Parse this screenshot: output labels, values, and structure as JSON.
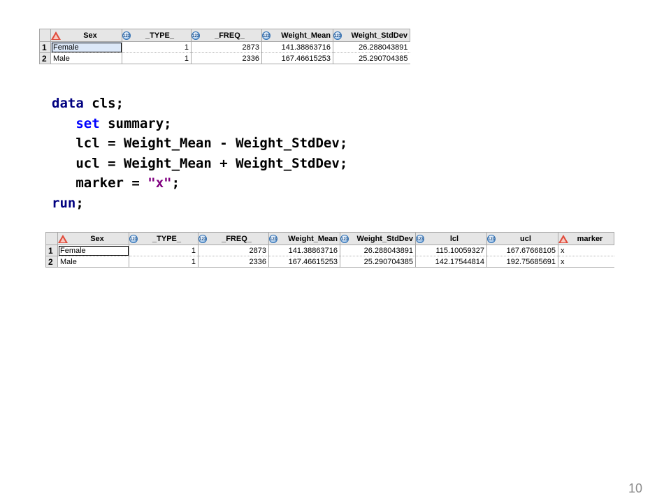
{
  "table1": {
    "columns": [
      "Sex",
      "_TYPE_",
      "_FREQ_",
      "Weight_Mean",
      "Weight_StdDev"
    ],
    "rows": [
      {
        "num": "1",
        "Sex": "Female",
        "TYPE": "1",
        "FREQ": "2873",
        "Weight_Mean": "141.38863716",
        "Weight_StdDev": "26.288043891"
      },
      {
        "num": "2",
        "Sex": "Male",
        "TYPE": "1",
        "FREQ": "2336",
        "Weight_Mean": "167.46615253",
        "Weight_StdDev": "25.290704385"
      }
    ]
  },
  "code": {
    "line1_kw": "data",
    "line1_rest": " cls;",
    "line2_kw": "set",
    "line2_rest": " summary;",
    "line3": "lcl = Weight_Mean - Weight_StdDev;",
    "line4": "ucl = Weight_Mean + Weight_StdDev;",
    "line5_pre": "marker = ",
    "line5_str": "\"x\"",
    "line5_post": ";",
    "line6_kw": "run",
    "line6_rest": ";"
  },
  "table2": {
    "columns": [
      "Sex",
      "_TYPE_",
      "_FREQ_",
      "Weight_Mean",
      "Weight_StdDev",
      "lcl",
      "ucl",
      "marker"
    ],
    "rows": [
      {
        "num": "1",
        "Sex": "Female",
        "TYPE": "1",
        "FREQ": "2873",
        "Weight_Mean": "141.38863716",
        "Weight_StdDev": "26.288043891",
        "lcl": "115.10059327",
        "ucl": "167.67668105",
        "marker": "x"
      },
      {
        "num": "2",
        "Sex": "Male",
        "TYPE": "1",
        "FREQ": "2336",
        "Weight_Mean": "167.46615253",
        "Weight_StdDev": "25.290704385",
        "lcl": "142.17544814",
        "ucl": "192.75685691",
        "marker": "x"
      }
    ]
  },
  "page_number": "10"
}
